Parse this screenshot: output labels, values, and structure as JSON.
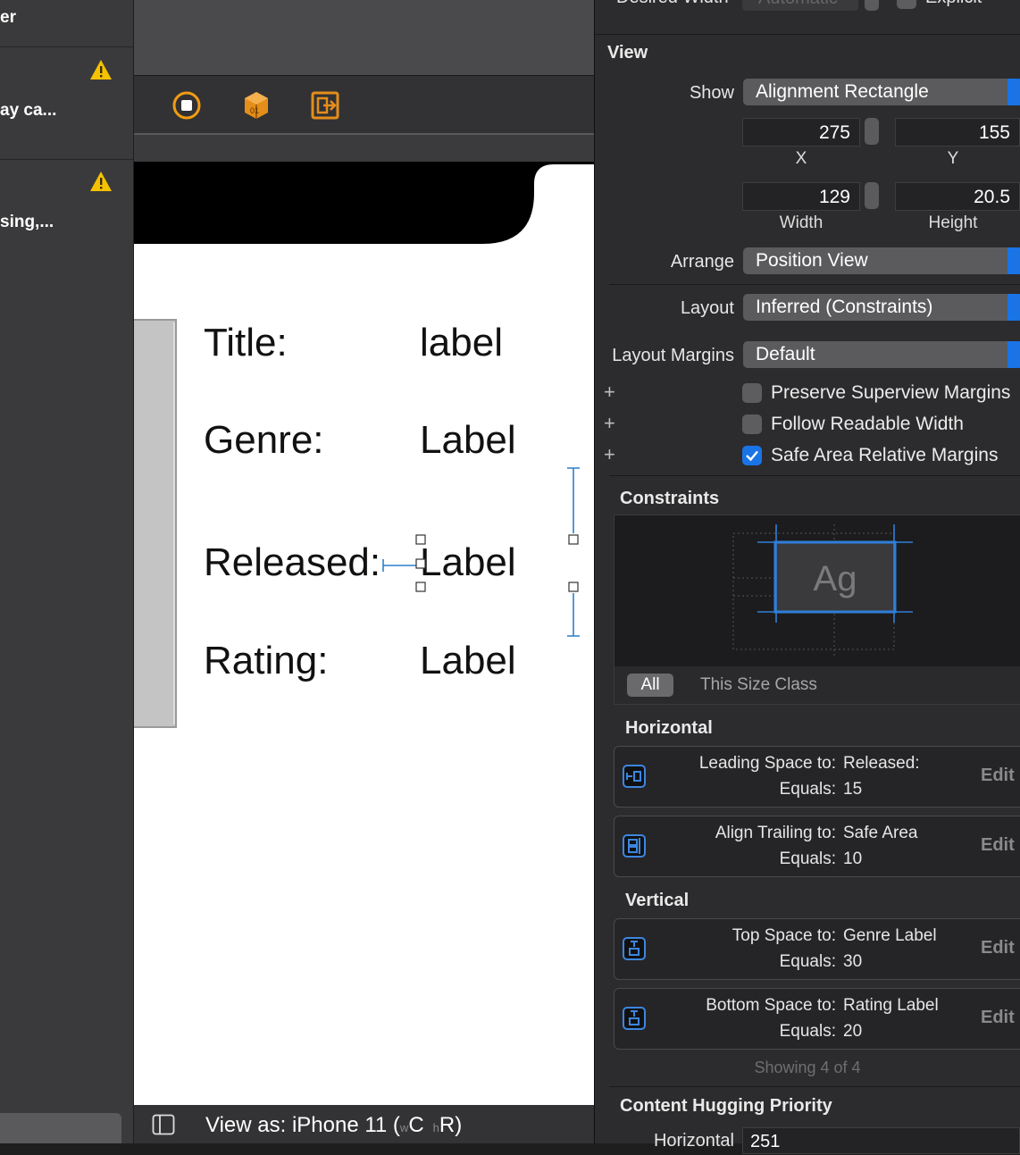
{
  "issues": {
    "header": "er",
    "items": [
      {
        "text": "ay ca..."
      },
      {
        "text": "sing,..."
      }
    ]
  },
  "toolbar": {
    "icons": [
      "stop-icon",
      "cube-icon",
      "exit-icon"
    ]
  },
  "canvas": {
    "rows": [
      {
        "key": "Title:",
        "value": "label"
      },
      {
        "key": "Genre:",
        "value": "Label"
      },
      {
        "key": "Released:",
        "value": "Label"
      },
      {
        "key": "Rating:",
        "value": "Label"
      }
    ]
  },
  "bottom_bar": {
    "view_as": "View as: iPhone 11 (",
    "w": "w",
    "c": "C",
    "h": "h",
    "r": "R",
    "close": ")"
  },
  "inspector": {
    "top_partial": {
      "desired_width": "Desired Width",
      "value": "Automatic",
      "explicit": "Explicit"
    },
    "view_section": "View",
    "show_label": "Show",
    "show_value": "Alignment Rectangle",
    "x": "275",
    "y": "155",
    "x_label": "X",
    "y_label": "Y",
    "width": "129",
    "height": "20.5",
    "width_label": "Width",
    "height_label": "Height",
    "arrange_label": "Arrange",
    "arrange_value": "Position View",
    "layout_label": "Layout",
    "layout_value": "Inferred (Constraints)",
    "margins_label": "Layout Margins",
    "margins_value": "Default",
    "checks": [
      {
        "label": "Preserve Superview Margins",
        "checked": false
      },
      {
        "label": "Follow Readable Width",
        "checked": false
      },
      {
        "label": "Safe Area Relative Margins",
        "checked": true
      }
    ],
    "constraints_title": "Constraints",
    "preview_text": "Ag",
    "filter_all": "All",
    "filter_size_class": "This Size Class",
    "horizontal_title": "Horizontal",
    "vertical_title": "Vertical",
    "constraints": [
      {
        "line1_key": "Leading Space to:",
        "line1_val": "Released:",
        "line2_key": "Equals:",
        "line2_val": "15",
        "edit": "Edit"
      },
      {
        "line1_key": "Align Trailing to:",
        "line1_val": "Safe Area",
        "line2_key": "Equals:",
        "line2_val": "10",
        "edit": "Edit"
      },
      {
        "line1_key": "Top Space to:",
        "line1_val": "Genre Label",
        "line2_key": "Equals:",
        "line2_val": "30",
        "edit": "Edit"
      },
      {
        "line1_key": "Bottom Space to:",
        "line1_val": "Rating Label",
        "line2_key": "Equals:",
        "line2_val": "20",
        "edit": "Edit"
      }
    ],
    "showing": "Showing 4 of 4",
    "hugging_title": "Content Hugging Priority",
    "hugging_h_label": "Horizontal",
    "hugging_h_value": "251"
  }
}
